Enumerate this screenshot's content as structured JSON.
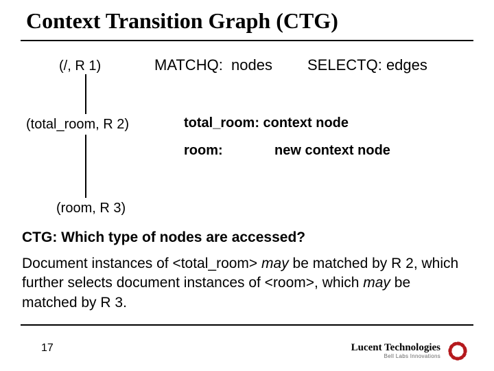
{
  "title": "Context Transition Graph (CTG)",
  "legend": {
    "matchq_label": "MATCHQ:",
    "matchq_value": "nodes",
    "selectq_label": "SELECTQ:",
    "selectq_value": "edges"
  },
  "graph": {
    "node1": "(/, R 1)",
    "node2": "(total_room, R 2)",
    "node3": "(room, R 3)"
  },
  "defs": {
    "total_room": "total_room: context node",
    "room_label": "room:",
    "room_value": "new context node"
  },
  "question": "CTG: Which type of nodes are accessed?",
  "paragraph": {
    "pre1": "Document instances of <total_room> ",
    "may1": "may",
    "mid1": " be matched by R 2, which further selects document instances of <room>, which ",
    "may2": "may",
    "post": " be matched by R 3."
  },
  "page_number": "17",
  "logo": {
    "brand": "Lucent Technologies",
    "tagline": "Bell Labs Innovations"
  }
}
